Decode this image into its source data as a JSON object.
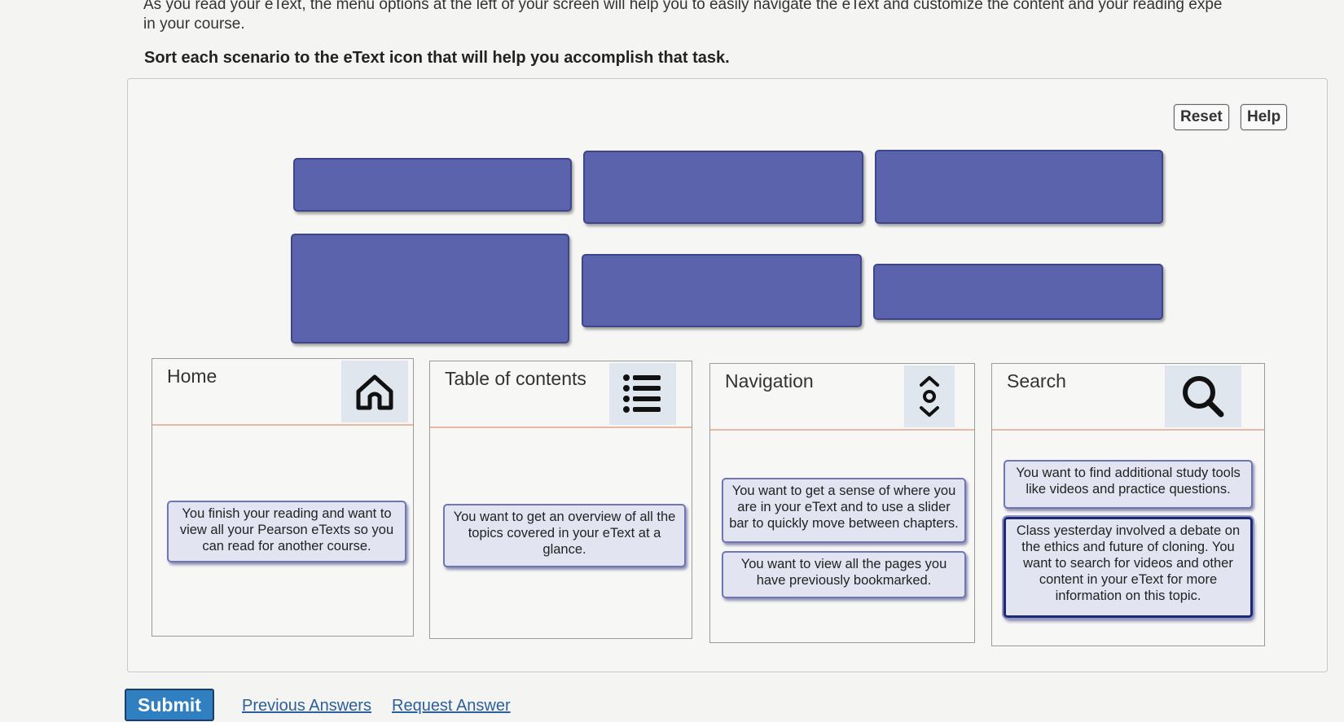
{
  "intro": {
    "line1": "As you read your eText, the menu options at the left of your screen will help you to easily navigate the eText and customize the content and your reading expe",
    "line2": "in your course."
  },
  "instruction": "Sort each scenario to the eText icon that will help you accomplish that task.",
  "toolbar": {
    "reset_label": "Reset",
    "help_label": "Help"
  },
  "bins": [
    {
      "title": "Home",
      "icon": "home-icon",
      "cards": [
        "You finish your reading and want to view all your Pearson eTexts so you can read for another course."
      ]
    },
    {
      "title": "Table of contents",
      "icon": "list-icon",
      "cards": [
        "You want to get an overview of all the topics covered in your eText at a glance."
      ]
    },
    {
      "title": "Navigation",
      "icon": "slider-icon",
      "cards": [
        "You want to get a sense of where you are in your eText and to use a slider bar to quickly move between chapters.",
        "You want to view all the pages you have previously bookmarked."
      ]
    },
    {
      "title": "Search",
      "icon": "search-icon",
      "cards": [
        "You want to find additional study tools like videos and practice questions.",
        "Class yesterday involved a debate on the ethics and future of cloning. You want to search for videos and other content in your eText for more information on this topic."
      ]
    }
  ],
  "footer": {
    "submit_label": "Submit",
    "previous_answers": "Previous Answers",
    "request_answer": "Request Answer"
  },
  "colors": {
    "slot": "#5b63ad",
    "card_bg": "#e2e5f1",
    "submit": "#2f7fc1",
    "link": "#2d5f9a"
  }
}
